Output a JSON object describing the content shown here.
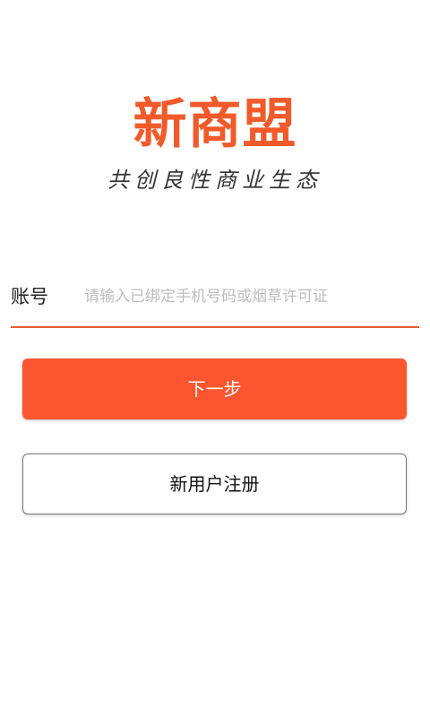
{
  "brand": {
    "name": "新商盟",
    "slogan": "共创良性商业生态",
    "accent_color": "#f25a2a"
  },
  "login_form": {
    "account_label": "账号",
    "account_placeholder": "请输入已绑定手机号码或烟草许可证",
    "account_value": ""
  },
  "actions": {
    "next_label": "下一步",
    "next_color": "#fb5630",
    "register_label": "新用户注册"
  }
}
